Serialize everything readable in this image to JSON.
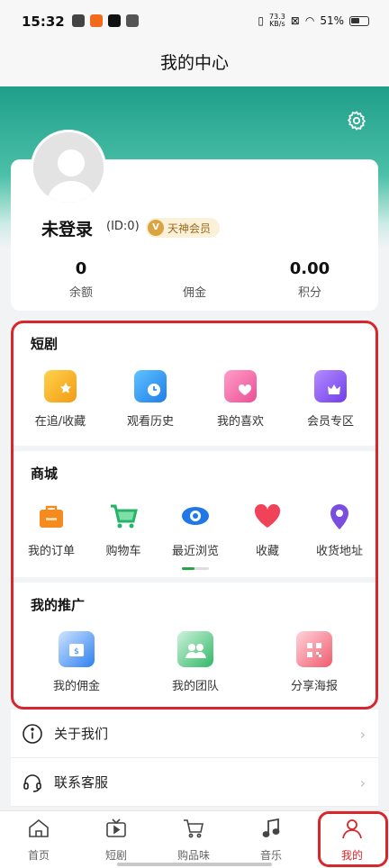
{
  "status_bar": {
    "time": "15:32",
    "net_speed_value": "73.3",
    "net_speed_unit": "KB/s",
    "battery": "51%"
  },
  "header": {
    "title": "我的中心"
  },
  "profile": {
    "username": "未登录",
    "id_text": "(ID:0)",
    "vip_badge": "天神会员",
    "stats": [
      {
        "value": "0",
        "label": "余额"
      },
      {
        "value": "",
        "label": "佣金"
      },
      {
        "value": "0.00",
        "label": "积分"
      }
    ]
  },
  "short_drama": {
    "title": "短剧",
    "items": [
      {
        "label": "在追/收藏",
        "icon": "star-collection-icon",
        "color": "#f6b21a"
      },
      {
        "label": "观看历史",
        "icon": "clock-history-icon",
        "color": "#2e8ff0"
      },
      {
        "label": "我的喜欢",
        "icon": "heart-like-icon",
        "color": "#f06aa8"
      },
      {
        "label": "会员专区",
        "icon": "crown-vip-icon",
        "color": "#8a5cf0"
      }
    ]
  },
  "mall": {
    "title": "商城",
    "items": [
      {
        "label": "我的订单",
        "icon": "bag-orders-icon",
        "color": "#f58a1f"
      },
      {
        "label": "购物车",
        "icon": "cart-icon",
        "color": "#27b36a"
      },
      {
        "label": "最近浏览",
        "icon": "eye-browse-icon",
        "color": "#1f78e6"
      },
      {
        "label": "收藏",
        "icon": "heart-favorite-icon",
        "color": "#f0435a"
      },
      {
        "label": "收货地址",
        "icon": "location-pin-icon",
        "color": "#7a4fe0"
      }
    ]
  },
  "promotion": {
    "title": "我的推广",
    "items": [
      {
        "label": "我的佣金",
        "icon": "commission-icon",
        "color": "#2d7ff0"
      },
      {
        "label": "我的团队",
        "icon": "team-icon",
        "color": "#32b866"
      },
      {
        "label": "分享海报",
        "icon": "qr-poster-icon",
        "color": "#ef5b6e"
      }
    ]
  },
  "menu": [
    {
      "label": "关于我们",
      "icon": "info-icon"
    },
    {
      "label": "联系客服",
      "icon": "headset-icon"
    }
  ],
  "tabs": [
    {
      "label": "首页",
      "icon": "home-icon"
    },
    {
      "label": "短剧",
      "icon": "tv-icon"
    },
    {
      "label": "购品味",
      "icon": "cart-icon"
    },
    {
      "label": "音乐",
      "icon": "music-note-icon"
    },
    {
      "label": "我的",
      "icon": "user-icon",
      "active": true
    }
  ],
  "accent_color": "#d9262c",
  "theme_green": "#1f9f8a"
}
